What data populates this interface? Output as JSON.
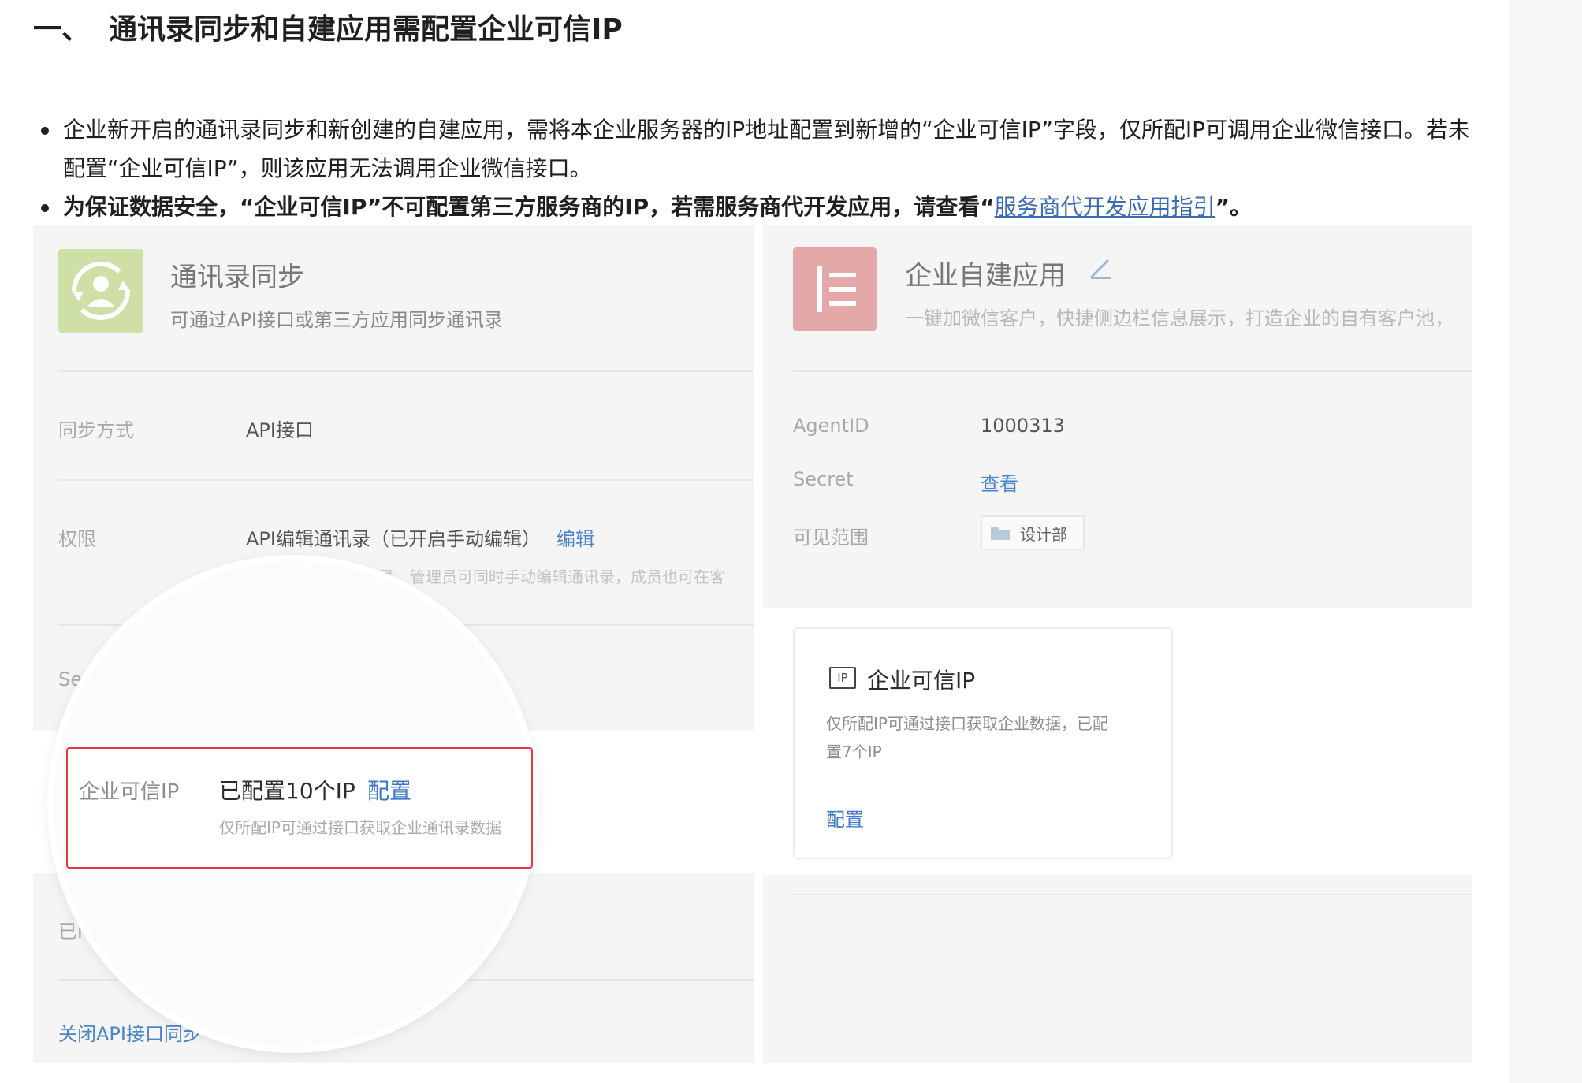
{
  "heading": {
    "number": "一、",
    "title": "通讯录同步和自建应用需配置企业可信IP"
  },
  "bullets": {
    "first": "企业新开启的通讯录同步和新创建的自建应用，需将本企业服务器的IP地址配置到新增的“企业可信IP”字段，仅所配IP可调用企业微信接口。若未配置“企业可信IP”，则该应用无法调用企业微信接口。",
    "second_bold": "为保证数据安全，“企业可信IP”不可配置第三方服务商的IP，若需服务商代开发应用，请查看",
    "second_link": "服务商代开发应用指引",
    "second_tail": "”。"
  },
  "left_panel": {
    "title": "通讯录同步",
    "subtitle": "可通过API接口或第三方应用同步通讯录",
    "row1_label": "同步方式",
    "row1_value": "API接口",
    "row2_label": "权限",
    "row2_value": "API编辑通讯录（已开启手动编辑）",
    "row2_link": "编辑",
    "row2_note": "录，管理员可同时手动编辑通讯录，成员也可在客",
    "row3_label": "Se",
    "row4_label": "已i",
    "close_link": "关闭API接口同步",
    "trusted_ip_label": "企业可信IP",
    "trusted_ip_value": "已配置10个IP",
    "trusted_ip_link": "配置",
    "trusted_ip_note": "仅所配IP可通过接口获取企业通讯录数据"
  },
  "right_panel": {
    "title": "企业自建应用",
    "subtitle": "一键加微信客户，快捷侧边栏信息展示，打造企业的自有客户池，",
    "agentid_label": "AgentID",
    "agentid_value": "1000313",
    "secret_label": "Secret",
    "secret_link": "查看",
    "scope_label": "可见范围",
    "scope_value": "设计部",
    "card_badge": "IP",
    "card_title": "企业可信IP",
    "card_desc_line1": "仅所配IP可通过接口获取企业数据，已配",
    "card_desc_line2": "置7个IP",
    "card_link": "配置"
  }
}
